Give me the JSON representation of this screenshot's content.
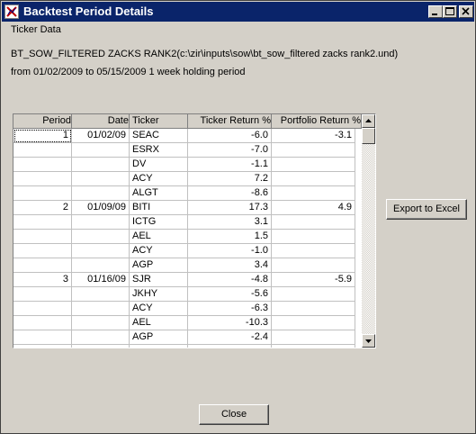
{
  "window": {
    "title": "Backtest Period Details",
    "icon": "app-icon"
  },
  "section_label": "Ticker Data",
  "dataset": "BT_SOW_FILTERED ZACKS RANK2(c:\\zir\\inputs\\sow\\bt_sow_filtered zacks rank2.und)",
  "period_text": "from 01/02/2009 to 05/15/2009 1 week holding period",
  "table": {
    "columns": [
      "Period",
      "Date",
      "Ticker",
      "Ticker Return %",
      "Portfolio Return %"
    ],
    "rows": [
      [
        "1",
        "01/02/09",
        "SEAC",
        "-6.0",
        "-3.1"
      ],
      [
        "",
        "",
        "ESRX",
        "-7.0",
        ""
      ],
      [
        "",
        "",
        "DV",
        "-1.1",
        ""
      ],
      [
        "",
        "",
        "ACY",
        "7.2",
        ""
      ],
      [
        "",
        "",
        "ALGT",
        "-8.6",
        ""
      ],
      [
        "2",
        "01/09/09",
        "BITI",
        "17.3",
        "4.9"
      ],
      [
        "",
        "",
        "ICTG",
        "3.1",
        ""
      ],
      [
        "",
        "",
        "AEL",
        "1.5",
        ""
      ],
      [
        "",
        "",
        "ACY",
        "-1.0",
        ""
      ],
      [
        "",
        "",
        "AGP",
        "3.4",
        ""
      ],
      [
        "3",
        "01/16/09",
        "SJR",
        "-4.8",
        "-5.9"
      ],
      [
        "",
        "",
        "JKHY",
        "-5.6",
        ""
      ],
      [
        "",
        "",
        "ACY",
        "-6.3",
        ""
      ],
      [
        "",
        "",
        "AEL",
        "-10.3",
        ""
      ],
      [
        "",
        "",
        "AGP",
        "-2.4",
        ""
      ],
      [
        "",
        "",
        "",
        "",
        ""
      ]
    ]
  },
  "buttons": {
    "export": "Export to Excel",
    "close": "Close"
  },
  "icons": {
    "minimize": "minimize-icon",
    "maximize": "maximize-icon",
    "close": "close-icon",
    "scroll_up": "arrow-up-icon",
    "scroll_down": "arrow-down-icon"
  },
  "colors": {
    "titlebar": "#0a246a",
    "face": "#d4d0c8"
  }
}
